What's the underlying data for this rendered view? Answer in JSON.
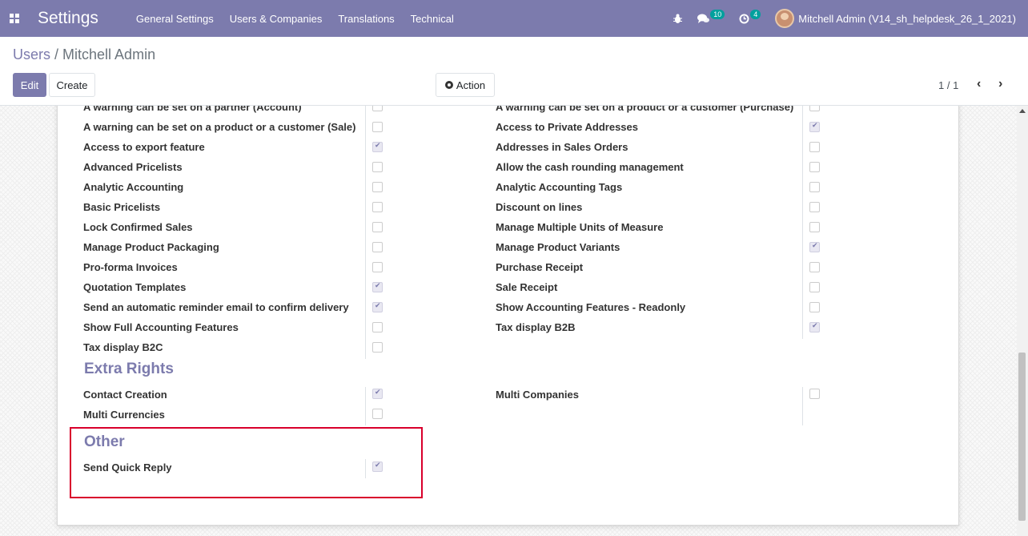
{
  "navbar": {
    "app_title": "Settings",
    "menu": [
      "General Settings",
      "Users & Companies",
      "Translations",
      "Technical"
    ],
    "messages_count": "10",
    "activities_count": "4",
    "user": "Mitchell Admin (V14_sh_helpdesk_26_1_2021)"
  },
  "breadcrumb": {
    "parent": "Users",
    "separator": "/",
    "current": "Mitchell Admin"
  },
  "buttons": {
    "edit": "Edit",
    "create": "Create",
    "action": "Action"
  },
  "pager": {
    "value": "1 / 1"
  },
  "technical_settings": {
    "left": [
      {
        "label": "A warning can be set on a partner (Account)",
        "checked": false
      },
      {
        "label": "A warning can be set on a product or a customer (Sale)",
        "checked": false
      },
      {
        "label": "Access to export feature",
        "checked": true
      },
      {
        "label": "Advanced Pricelists",
        "checked": false
      },
      {
        "label": "Analytic Accounting",
        "checked": false
      },
      {
        "label": "Basic Pricelists",
        "checked": false
      },
      {
        "label": "Lock Confirmed Sales",
        "checked": false
      },
      {
        "label": "Manage Product Packaging",
        "checked": false
      },
      {
        "label": "Pro-forma Invoices",
        "checked": false
      },
      {
        "label": "Quotation Templates",
        "checked": true
      },
      {
        "label": "Send an automatic reminder email to confirm delivery",
        "checked": true
      },
      {
        "label": "Show Full Accounting Features",
        "checked": false
      },
      {
        "label": "Tax display B2C",
        "checked": false
      }
    ],
    "right": [
      {
        "label": "A warning can be set on a product or a customer (Purchase)",
        "checked": false
      },
      {
        "label": "Access to Private Addresses",
        "checked": true
      },
      {
        "label": "Addresses in Sales Orders",
        "checked": false
      },
      {
        "label": "Allow the cash rounding management",
        "checked": false
      },
      {
        "label": "Analytic Accounting Tags",
        "checked": false
      },
      {
        "label": "Discount on lines",
        "checked": false
      },
      {
        "label": "Manage Multiple Units of Measure",
        "checked": false
      },
      {
        "label": "Manage Product Variants",
        "checked": true
      },
      {
        "label": "Purchase Receipt",
        "checked": false
      },
      {
        "label": "Sale Receipt",
        "checked": false
      },
      {
        "label": "Show Accounting Features - Readonly",
        "checked": false
      },
      {
        "label": "Tax display B2B",
        "checked": true
      }
    ]
  },
  "extra_rights": {
    "title": "Extra Rights",
    "left": [
      {
        "label": "Contact Creation",
        "checked": true
      },
      {
        "label": "Multi Currencies",
        "checked": false
      }
    ],
    "right": [
      {
        "label": "Multi Companies",
        "checked": false
      }
    ]
  },
  "other": {
    "title": "Other",
    "left": [
      {
        "label": "Send Quick Reply",
        "checked": true
      }
    ]
  },
  "colors": {
    "brand": "#7c7bad",
    "highlight": "#d9002c",
    "badge": "#00a09d"
  }
}
